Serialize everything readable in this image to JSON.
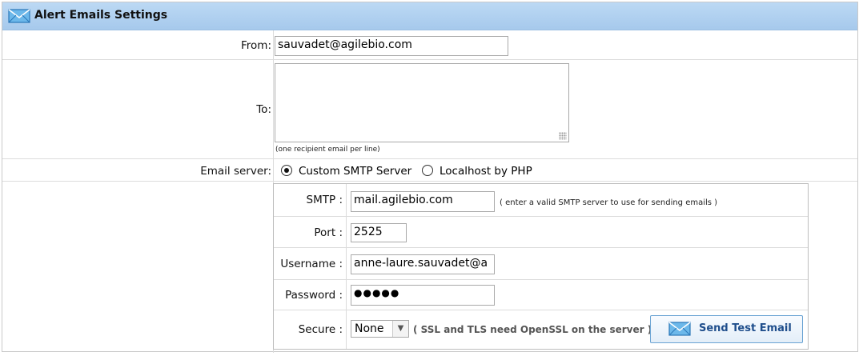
{
  "header": {
    "title": "Alert Emails Settings",
    "icon": "envelope-icon"
  },
  "from": {
    "label": "From:",
    "value": "sauvadet@agilebio.com"
  },
  "to": {
    "label": "To:",
    "value": "",
    "hint": "(one recipient email per line)"
  },
  "email_server": {
    "label": "Email server:",
    "options": [
      "Custom SMTP Server",
      "Localhost by PHP"
    ],
    "selected": "Custom SMTP Server"
  },
  "smtp": {
    "smtp_label": "SMTP :",
    "smtp_value": "mail.agilebio.com",
    "smtp_note": "( enter a valid SMTP server to use for sending emails )",
    "port_label": "Port :",
    "port_value": "2525",
    "username_label": "Username :",
    "username_value": "anne-laure.sauvadet@a",
    "password_label": "Password :",
    "password_masked": "●●●●●",
    "secure_label": "Secure :",
    "secure_value": "None",
    "secure_note": "( SSL and TLS need OpenSSL on the server )"
  },
  "send_test": {
    "label": "Send Test Email",
    "icon": "envelope-icon"
  },
  "colors": {
    "header_bg": "#a6c9ec",
    "button_text": "#1f4e8c",
    "border": "#dcdcdc"
  }
}
